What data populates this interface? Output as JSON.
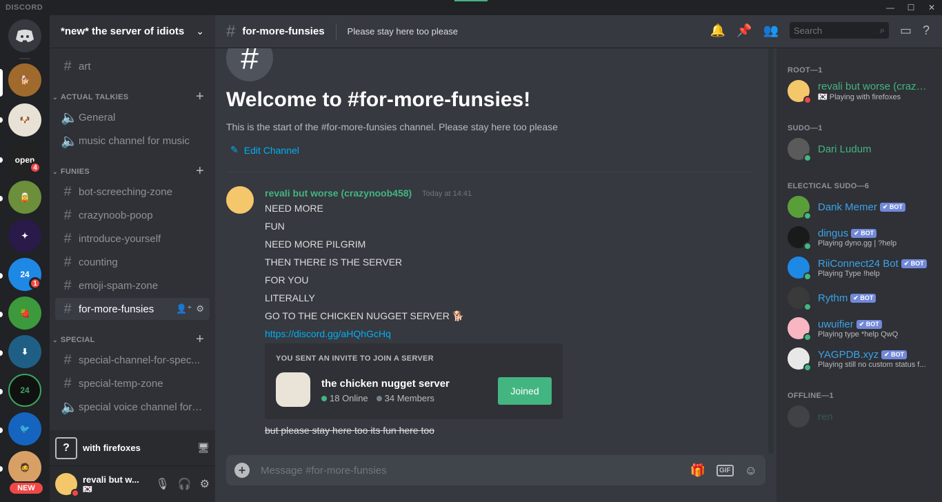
{
  "titlebar": {
    "brand": "DISCORD",
    "minimize": "—",
    "maximize": "☐",
    "close": "✕"
  },
  "guilds": {
    "home_icon": "discord-logo-icon",
    "items": [
      {
        "label": "🐕",
        "color": "#a06a2c",
        "selected": true
      },
      {
        "label": "🐶",
        "color": "#e8e2d6"
      },
      {
        "label": "open",
        "color": "#222",
        "badge": "4"
      },
      {
        "label": "🧝",
        "color": "#6b8f3a"
      },
      {
        "label": "✦",
        "color": "#2a1a4a"
      },
      {
        "label": "24",
        "color": "#1e88e5",
        "badge": "1"
      },
      {
        "label": "🍓",
        "color": "#3c9a3c"
      },
      {
        "label": "⬇",
        "color": "#1f5f86"
      },
      {
        "label": "24",
        "color": "#111"
      },
      {
        "label": "🐦",
        "color": "#1565c0"
      },
      {
        "label": "🧔",
        "color": "#d9a066"
      }
    ],
    "new_badge": "NEW"
  },
  "server": {
    "name": "*new* the server of idiots"
  },
  "categories": {
    "actual_talkies": "ACTUAL TALKIES",
    "funies": "FUNIES",
    "special": "SPECIAL"
  },
  "channels": {
    "art": "art",
    "general": "General",
    "music": "music channel for music",
    "bot_screeching": "bot-screeching-zone",
    "crazynoob_poop": "crazynoob-poop",
    "introduce": "introduce-yourself",
    "counting": "counting",
    "emoji_spam": "emoji-spam-zone",
    "for_more_funsies": "for-more-funsies",
    "special_channel": "special-channel-for-spec...",
    "special_temp": "special-temp-zone",
    "special_voice": "special voice channel for ..."
  },
  "activity": {
    "icon_text": "?",
    "label": "with firefoxes"
  },
  "user": {
    "name": "revali but w...",
    "flag": "🇰🇷"
  },
  "header": {
    "channel": "for-more-funsies",
    "topic": "Please stay here too please",
    "search_placeholder": "Search"
  },
  "welcome": {
    "title": "Welcome to #for-more-funsies!",
    "subtitle": "This is the start of the #for-more-funsies channel. Please stay here too please",
    "edit": "Edit Channel"
  },
  "message": {
    "author": "revali but worse (crazynoob458)",
    "time": "Today at 14:41",
    "lines": [
      "NEED MORE",
      "FUN",
      "NEED MORE PILGRIM",
      "THEN THERE IS THE SERVER",
      "FOR YOU",
      "LITERALLY",
      "GO TO THE CHICKEN NUGGET SERVER 🐕"
    ],
    "link": "https://discord.gg/aHQhGcHq",
    "struck": "but please stay here too its fun here too"
  },
  "invite": {
    "title": "YOU SENT AN INVITE TO JOIN A SERVER",
    "server": "the chicken nugget server",
    "online": "18 Online",
    "members": "34 Members",
    "button": "Joined"
  },
  "composer": {
    "placeholder": "Message #for-more-funsies",
    "gif": "GIF"
  },
  "members": {
    "groups": {
      "root": "ROOT—1",
      "sudo": "SUDO—1",
      "electical": "ELECTICAL SUDO—6",
      "offline": "OFFLINE—1"
    },
    "list": {
      "revali": {
        "name": "revali but worse (crazynoob458)",
        "activity": "🇰🇷 Playing with firefoxes",
        "color": "#43b581"
      },
      "dari": {
        "name": "Dari Ludum",
        "color": "#43b581"
      },
      "dank": {
        "name": "Dank Memer",
        "bot": "✔ BOT",
        "color": "#3ba3ea"
      },
      "dingus": {
        "name": "dingus",
        "bot": "✔ BOT",
        "activity": "Playing dyno.gg | ?help",
        "color": "#3ba3ea"
      },
      "rii": {
        "name": "RiiConnect24 Bot",
        "bot": "✔ BOT",
        "activity": "Playing Type !help",
        "color": "#3ba3ea"
      },
      "rythm": {
        "name": "Rythm",
        "bot": "✔ BOT",
        "color": "#3ba3ea"
      },
      "uwuifier": {
        "name": "uwuifier",
        "bot": "✔ BOT",
        "activity": "Playing type *help QwQ",
        "color": "#3ba3ea"
      },
      "yagpdb": {
        "name": "YAGPDB.xyz",
        "bot": "✔ BOT",
        "activity": "Playing still no custom status f...",
        "color": "#3ba3ea"
      },
      "ren": {
        "name": "ren",
        "color": "#43b581"
      }
    }
  }
}
